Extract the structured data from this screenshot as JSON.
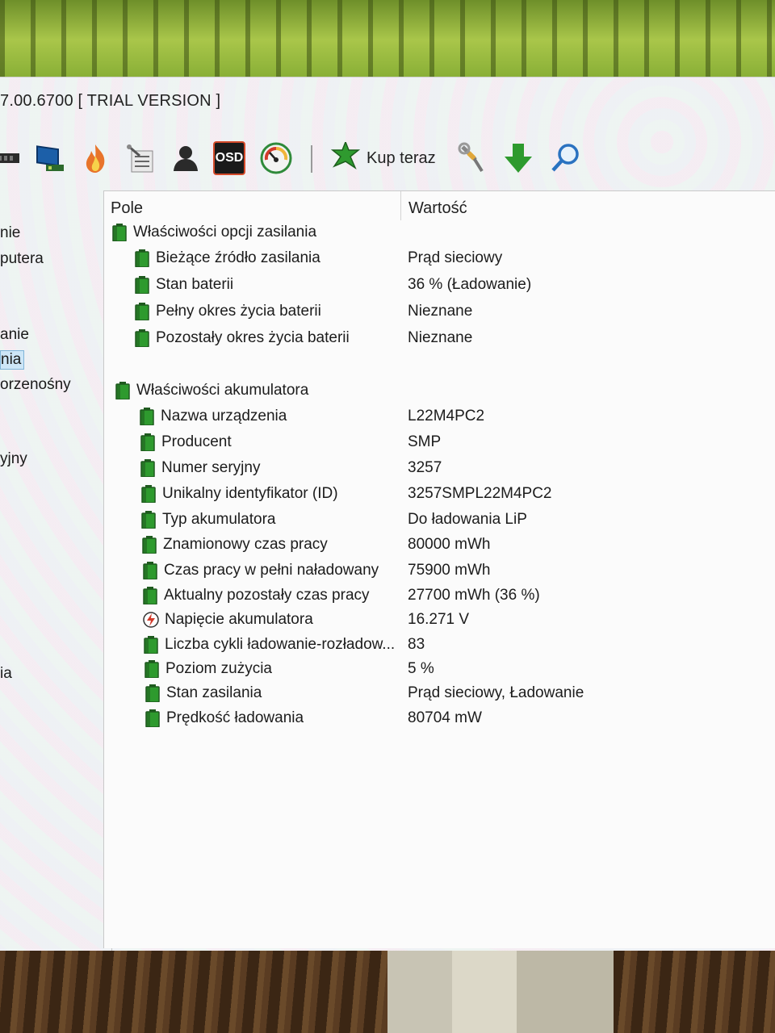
{
  "window": {
    "title": "7.00.6700  [ TRIAL VERSION ]"
  },
  "toolbar": {
    "icons": [
      "motherboard-icon",
      "monitor-icon",
      "flame-icon",
      "tools-list-icon",
      "user-icon",
      "osd-icon",
      "gauge-icon",
      "buy-star-icon",
      "wrench-icon",
      "download-icon",
      "search-icon"
    ],
    "osd_label": "OSD",
    "buy_label": "Kup teraz"
  },
  "nav": {
    "items": [
      {
        "label": "nie"
      },
      {
        "label": "putera"
      },
      {
        "label": "anie"
      },
      {
        "label": "nia",
        "selected": true
      },
      {
        "label": "orzenośny"
      },
      {
        "label": "yjny"
      },
      {
        "label": "ia"
      }
    ]
  },
  "list": {
    "col_field": "Pole",
    "col_value": "Wartość",
    "group1": {
      "title": "Właściwości opcji zasilania",
      "rows": [
        {
          "field": "Bieżące źródło zasilania",
          "value": "Prąd sieciowy"
        },
        {
          "field": "Stan baterii",
          "value": "36 % (Ładowanie)"
        },
        {
          "field": "Pełny okres życia baterii",
          "value": "Nieznane"
        },
        {
          "field": "Pozostały okres życia baterii",
          "value": "Nieznane"
        }
      ]
    },
    "group2": {
      "title": "Właściwości akumulatora",
      "rows": [
        {
          "field": "Nazwa urządzenia",
          "value": "L22M4PC2"
        },
        {
          "field": "Producent",
          "value": "SMP"
        },
        {
          "field": "Numer seryjny",
          "value": "3257"
        },
        {
          "field": "Unikalny identyfikator (ID)",
          "value": "3257SMPL22M4PC2"
        },
        {
          "field": "Typ akumulatora",
          "value": "Do ładowania LiP"
        },
        {
          "field": "Znamionowy czas pracy",
          "value": "80000 mWh"
        },
        {
          "field": "Czas pracy w pełni naładowany",
          "value": "75900 mWh"
        },
        {
          "field": "Aktualny pozostały czas pracy",
          "value": "27700 mWh  (36 %)"
        },
        {
          "field": "Napięcie akumulatora",
          "value": "16.271 V",
          "icon": "voltage-icon"
        },
        {
          "field": "Liczba cykli ładowanie-rozładow...",
          "value": "83"
        },
        {
          "field": "Poziom zużycia",
          "value": "5 %"
        },
        {
          "field": "Stan zasilania",
          "value": "Prąd sieciowy, Ładowanie"
        },
        {
          "field": "Prędkość ładowania",
          "value": "80704 mW"
        }
      ]
    }
  },
  "colors": {
    "battery_green": "#2e9a2e",
    "battery_dark": "#1f5a1f",
    "selection": "#cde6f7"
  }
}
